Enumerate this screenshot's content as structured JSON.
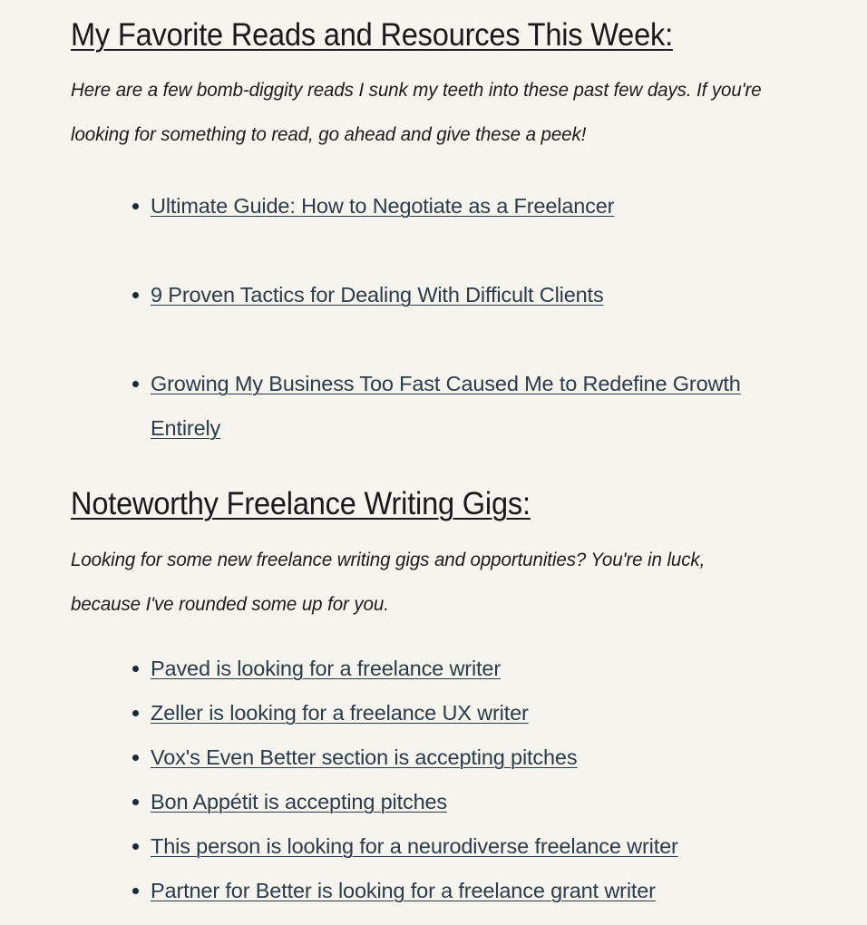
{
  "theme": {
    "background": "#f5f4ef",
    "heading_color": "#191919",
    "body_color": "#1b1b1b",
    "link_color": "#2d3a47",
    "bullet_color": "#1f2933"
  },
  "sections": [
    {
      "heading": "My Favorite Reads and Resources This Week:",
      "intro": "Here are a few bomb-diggity reads I sunk my teeth into these past few days. If you're looking for something to read, go ahead and give these a peek!",
      "links": [
        "Ultimate Guide: How to Negotiate as a Freelancer",
        "9 Proven Tactics for Dealing With Difficult Clients",
        "Growing My Business Too Fast Caused Me to Redefine Growth Entirely"
      ]
    },
    {
      "heading": "Noteworthy Freelance Writing Gigs:",
      "intro": "Looking for some new freelance writing gigs and opportunities? You're in luck, because I've rounded some up for you.",
      "links": [
        "Paved is looking for a freelance writer",
        "Zeller is looking for a freelance UX writer",
        "Vox's Even Better section is accepting pitches",
        "Bon Appétit is accepting pitches",
        "This person is looking for a neurodiverse freelance writer",
        "Partner for Better is looking for a freelance grant writer"
      ]
    }
  ]
}
